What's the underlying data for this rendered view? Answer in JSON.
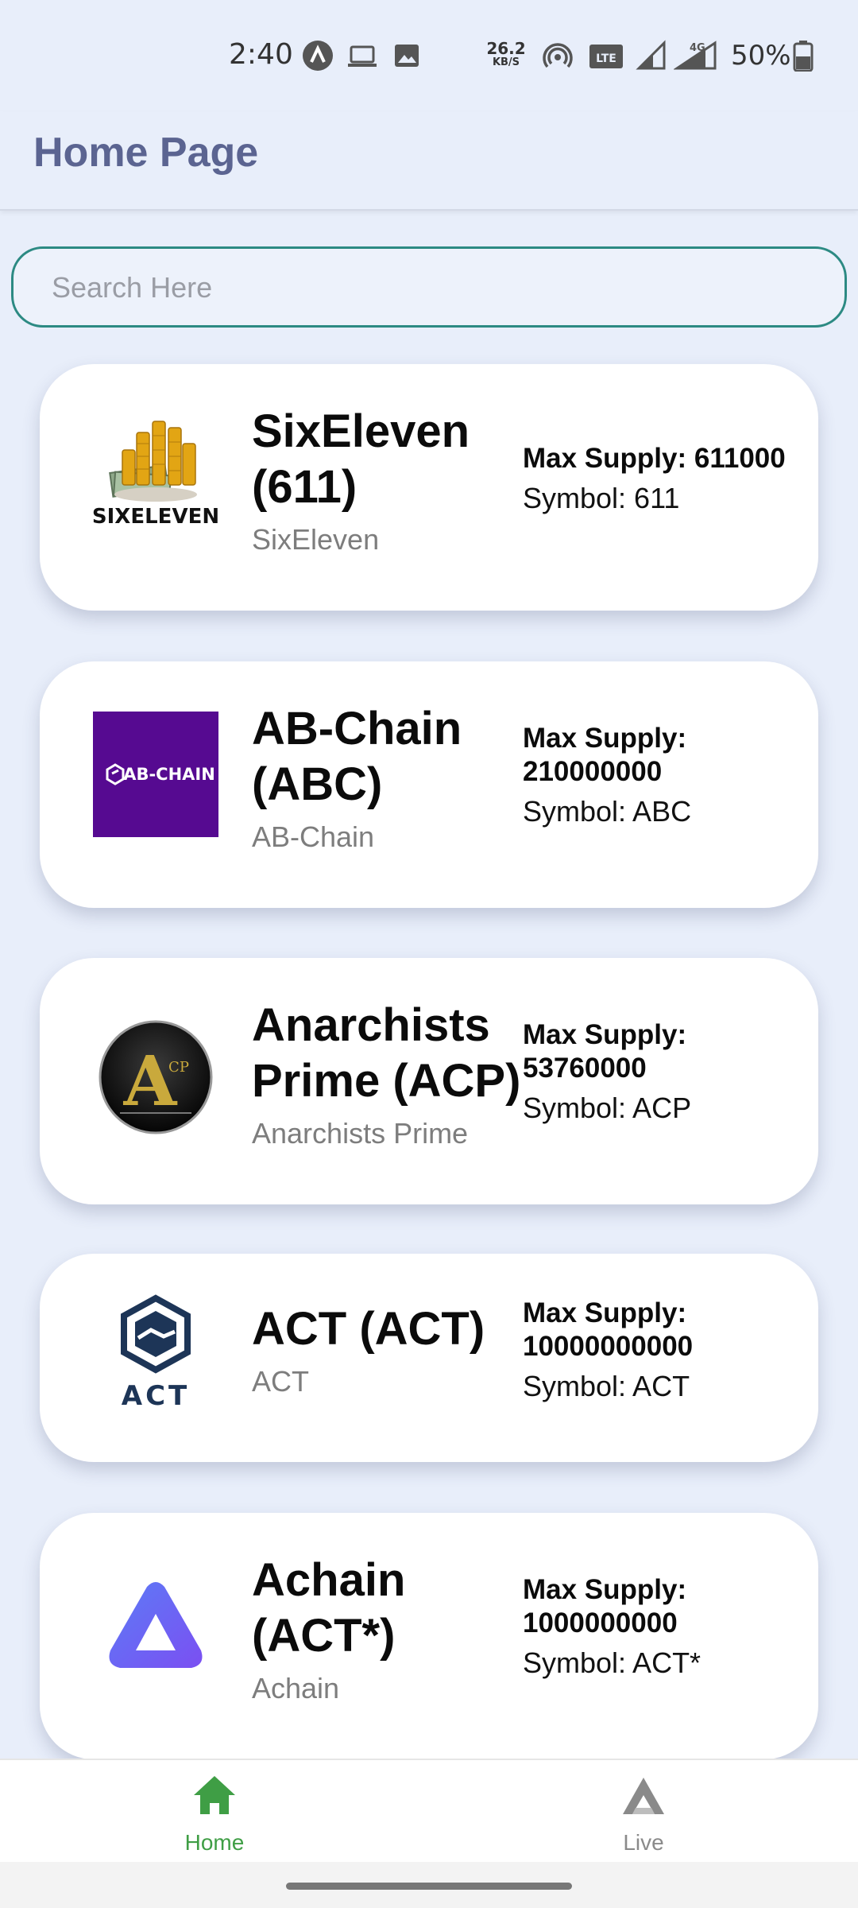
{
  "status_bar": {
    "time": "2:40",
    "net_speed": "26.2",
    "net_unit": "KB/S",
    "network_type": "4G",
    "battery": "50%"
  },
  "header": {
    "title": "Home Page"
  },
  "search": {
    "placeholder": "Search Here",
    "value": ""
  },
  "coins": [
    {
      "name": "SixEleven (611)",
      "subtitle": "SixEleven",
      "max_supply": "Max Supply: 611000",
      "symbol": "Symbol: 611",
      "logo_text": "SIXELEVEN"
    },
    {
      "name": "AB-Chain (ABC)",
      "subtitle": "AB-Chain",
      "max_supply": "Max Supply: 210000000",
      "symbol": "Symbol: ABC",
      "logo_text": "AB-CHAIN"
    },
    {
      "name": "Anarchists Prime (ACP)",
      "subtitle": "Anarchists Prime",
      "max_supply": "Max Supply: 53760000",
      "symbol": "Symbol: ACP",
      "logo_text": "A"
    },
    {
      "name": "ACT (ACT)",
      "subtitle": "ACT",
      "max_supply": "Max Supply: 10000000000",
      "symbol": "Symbol: ACT",
      "logo_text": "ACT"
    },
    {
      "name": "Achain (ACT*)",
      "subtitle": "Achain",
      "max_supply": "Max Supply: 1000000000",
      "symbol": "Symbol: ACT*",
      "logo_text": ""
    }
  ],
  "bottom_nav": [
    {
      "label": "Home",
      "icon": "home-icon",
      "active": true,
      "color": "#3f9e45"
    },
    {
      "label": "Live",
      "icon": "live-icon",
      "active": false,
      "color": "#8a8a8a"
    }
  ],
  "colors": {
    "background": "#e8eefa",
    "header_title": "#5b6491",
    "search_border": "#2c8a83",
    "nav_active": "#3f9e45"
  }
}
